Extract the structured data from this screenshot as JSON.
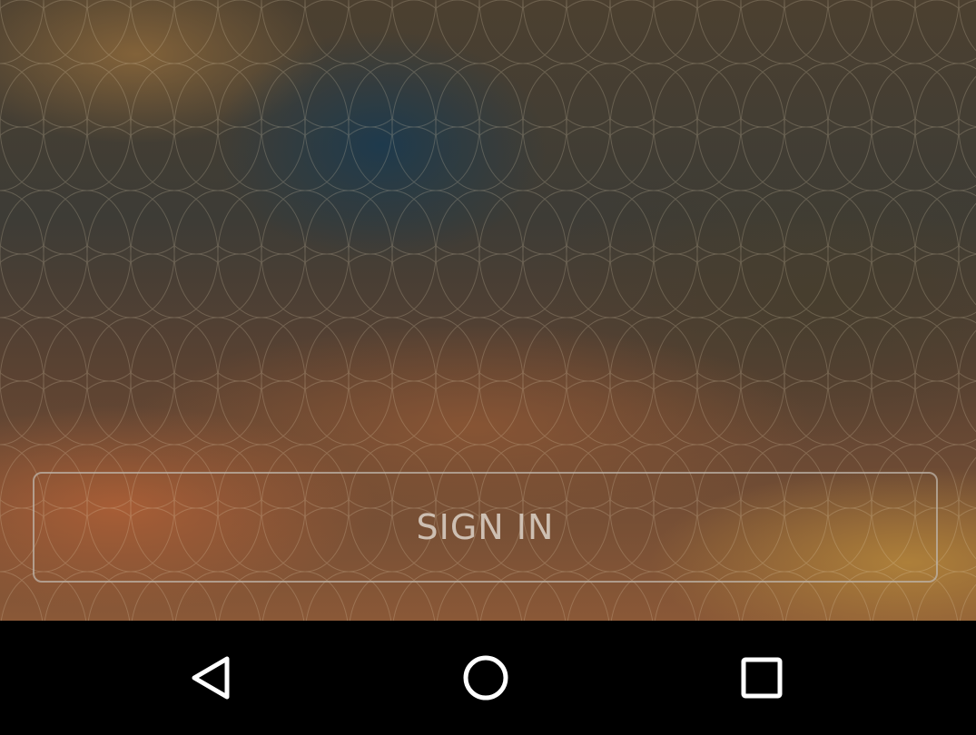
{
  "login": {
    "sign_in_label": "SIGN IN"
  },
  "navigation_bar": {
    "buttons": [
      {
        "icon": "back-icon"
      },
      {
        "icon": "home-icon"
      },
      {
        "icon": "recents-icon"
      }
    ]
  },
  "colors": {
    "nav_background": "#000000",
    "nav_icon": "#ffffff",
    "button_border": "#beb4aa",
    "button_text": "#dcd2c8"
  }
}
